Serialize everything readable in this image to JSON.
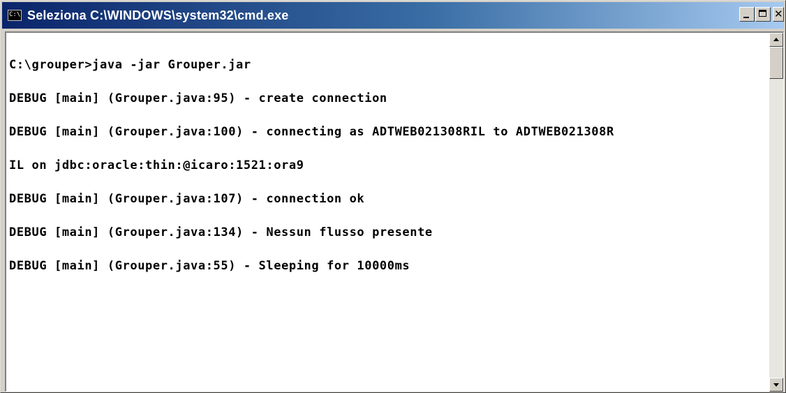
{
  "window": {
    "title": "Seleziona C:\\WINDOWS\\system32\\cmd.exe",
    "icon": "cmd-console-icon",
    "icon_text": "C:\\",
    "title_gradient": [
      "#0a246a",
      "#3a6ea5",
      "#a6caf0"
    ],
    "buttons": {
      "minimize": "minimize-icon",
      "maximize": "maximize-icon",
      "close": "close-icon"
    }
  },
  "console": {
    "background": "#ffffff",
    "foreground": "#000000",
    "lines": [
      "C:\\grouper>java -jar Grouper.jar",
      "DEBUG [main] (Grouper.java:95) - create connection",
      "DEBUG [main] (Grouper.java:100) - connecting as ADTWEB021308RIL to ADTWEB021308R",
      "IL on jdbc:oracle:thin:@icaro:1521:ora9",
      "DEBUG [main] (Grouper.java:107) - connection ok",
      "DEBUG [main] (Grouper.java:134) - Nessun flusso presente",
      "DEBUG [main] (Grouper.java:55) - Sleeping for 10000ms"
    ]
  },
  "scrollbar": {
    "up_icon": "scroll-up-arrow-icon",
    "down_icon": "scroll-down-arrow-icon"
  }
}
